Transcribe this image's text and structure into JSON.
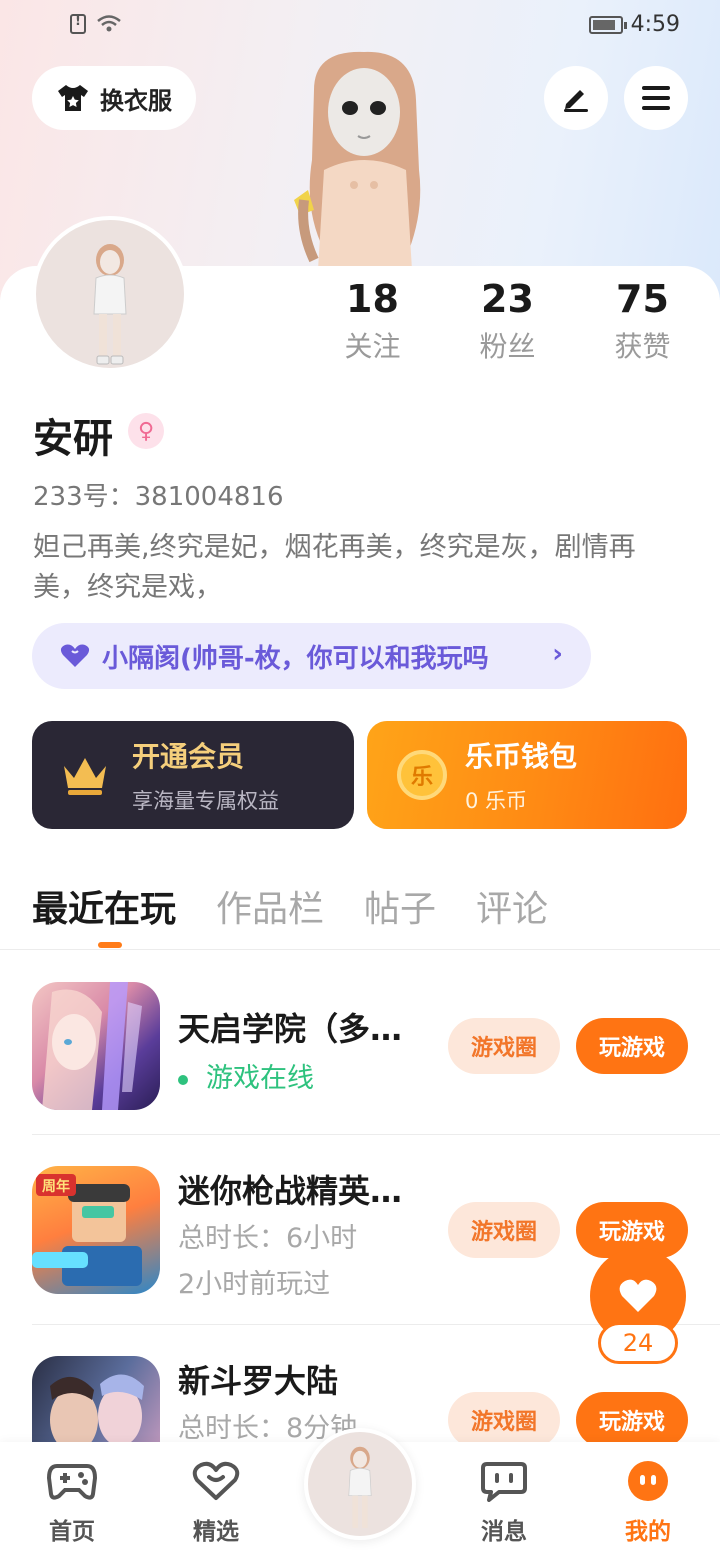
{
  "status_bar": {
    "time": "4:59"
  },
  "header": {
    "dress_label": "换衣服",
    "edit_icon": "pen-icon",
    "menu_icon": "menu-icon"
  },
  "stats": [
    {
      "value": "18",
      "label": "关注"
    },
    {
      "value": "23",
      "label": "粉丝"
    },
    {
      "value": "75",
      "label": "获赞"
    }
  ],
  "profile": {
    "name": "安研",
    "gender_symbol": "♀",
    "uid": "233号：381004816",
    "bio": "妲己再美,终究是妃，烟花再美，终究是灰，剧情再美，终究是戏，"
  },
  "group": {
    "label": "小隔阂(帅哥-枚，你可以和我玩吗"
  },
  "vip": {
    "title": "开通会员",
    "subtitle": "享海量专属权益"
  },
  "wallet": {
    "title": "乐币钱包",
    "subtitle": "0 乐币",
    "coin_char": "乐"
  },
  "tabs": [
    {
      "label": "最近在玩",
      "active": true
    },
    {
      "label": "作品栏",
      "active": false
    },
    {
      "label": "帖子",
      "active": false
    },
    {
      "label": "评论",
      "active": false
    }
  ],
  "games": [
    {
      "title": "天启学院（多…",
      "line1": "游戏在线",
      "line2": "",
      "circle_btn": "游戏圈",
      "play_btn": "玩游戏"
    },
    {
      "title": "迷你枪战精英…",
      "line1": "总时长：6小时",
      "line2": "2小时前玩过",
      "circle_btn": "游戏圈",
      "play_btn": "玩游戏",
      "badge": "周年"
    },
    {
      "title": "新斗罗大陆",
      "line1": "总时长：8分钟",
      "line2": "",
      "circle_btn": "游戏圈",
      "play_btn": "玩游戏"
    }
  ],
  "like": {
    "count": "24"
  },
  "nav": [
    {
      "label": "首页",
      "icon": "gamepad-icon"
    },
    {
      "label": "精选",
      "icon": "heart-chat-icon"
    },
    {
      "label": "消息",
      "icon": "message-icon"
    },
    {
      "label": "我的",
      "icon": "profile-face-icon",
      "active": true
    }
  ],
  "colors": {
    "accent": "#ff7413",
    "vip_gold": "#f5cf7c",
    "purple": "#6a5ad9",
    "online_green": "#2ec27e"
  }
}
